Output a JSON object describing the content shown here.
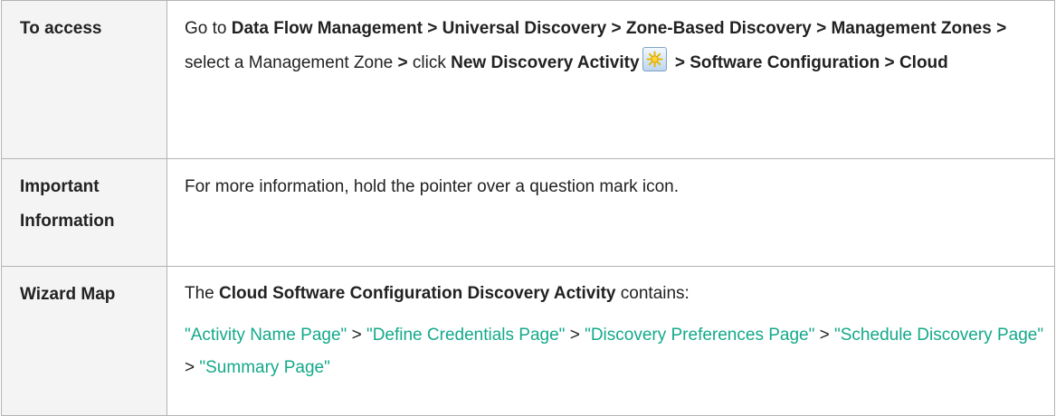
{
  "rows": {
    "access": {
      "label": "To access",
      "go_to": "Go to ",
      "path1": "Data Flow Management",
      "path2": "Universal Discovery",
      "path3": "Zone-Based Discovery",
      "path4": "Management Zones",
      "gt": ">",
      "select_text": " select a Management Zone ",
      "click_text": " click ",
      "path5": "New Discovery Activity",
      "path6": "Software Configuration",
      "path7": "Cloud",
      "icon": "new-activity-icon"
    },
    "important": {
      "label": "Important Information",
      "text": "For more information, hold the pointer over a question mark icon."
    },
    "wizard": {
      "label": "Wizard Map",
      "intro_pre": "The ",
      "intro_bold": "Cloud Software Configuration Discovery Activity",
      "intro_post": " contains:",
      "gt": ">",
      "links": [
        "\"Activity Name Page\"",
        "\"Define Credentials Page\"",
        "\"Discovery Preferences Page\"",
        "\"Schedule Discovery Page\"",
        "\"Summary Page\""
      ]
    }
  },
  "colors": {
    "link": "#14a98a",
    "border": "#b4b4b4",
    "text": "#222222",
    "label_bg": "#f4f4f4"
  }
}
